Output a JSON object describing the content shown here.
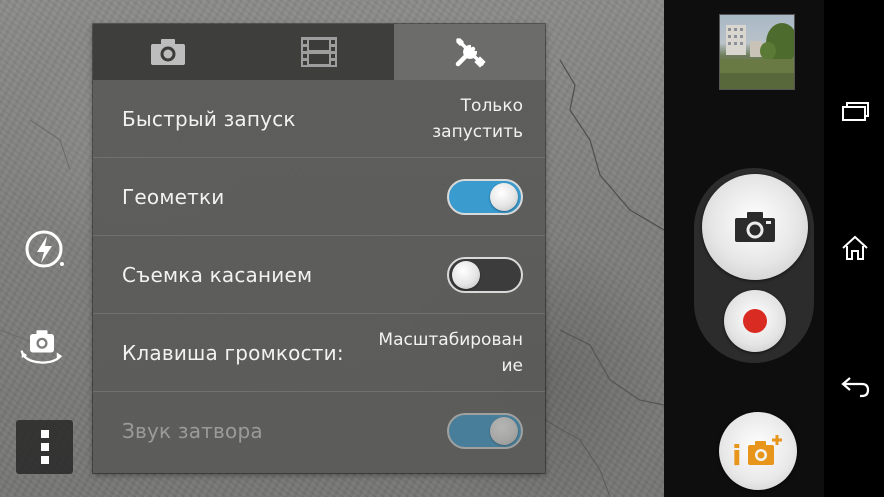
{
  "settings_panel": {
    "tabs": [
      {
        "icon": "camera-icon",
        "active": false
      },
      {
        "icon": "film-icon",
        "active": false
      },
      {
        "icon": "tools-icon",
        "active": true
      }
    ],
    "rows": [
      {
        "label": "Быстрый запуск",
        "value_line1": "Только",
        "value_line2": "запустить"
      },
      {
        "label": "Геометки",
        "toggle": "on"
      },
      {
        "label": "Съемка касанием",
        "toggle": "off"
      },
      {
        "label": "Клавиша громкости:",
        "value_line1": "Масштабирован",
        "value_line2": "ие"
      },
      {
        "label": "Звук затвора",
        "toggle": "on",
        "disabled": true
      }
    ]
  },
  "left_controls": [
    "flash-auto-icon",
    "switch-camera-icon",
    "more-menu-icon"
  ],
  "right_controls": {
    "gallery_thumbnail": "gallery-thumbnail",
    "shutter": "camera-icon",
    "record": "record-icon",
    "app_button_text": "i"
  },
  "nav_bar": [
    "recent-apps-icon",
    "home-icon",
    "back-icon"
  ],
  "colors": {
    "toggle_on": "#3a9bcf",
    "record": "#d92b22",
    "app_accent": "#e7961b"
  }
}
